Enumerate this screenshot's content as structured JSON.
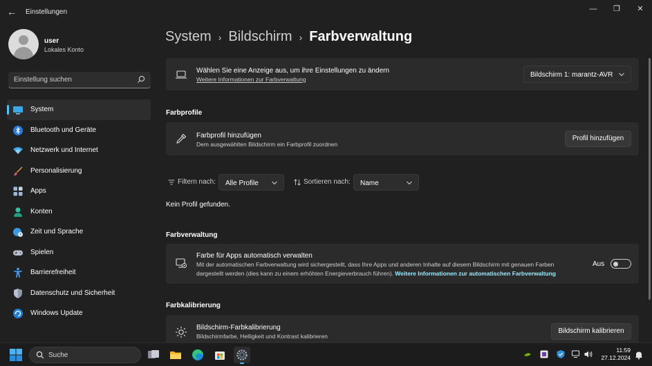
{
  "window": {
    "title": "Einstellungen",
    "back_glyph": "←",
    "minimize_glyph": "—",
    "maximize_glyph": "❐",
    "close_glyph": "✕"
  },
  "user": {
    "name": "user",
    "account": "Lokales Konto"
  },
  "search": {
    "placeholder": "Einstellung suchen"
  },
  "nav": {
    "items": [
      {
        "label": "System",
        "icon": "system-monitor-icon",
        "active": true
      },
      {
        "label": "Bluetooth und Geräte",
        "icon": "bluetooth-icon"
      },
      {
        "label": "Netzwerk und Internet",
        "icon": "wifi-icon"
      },
      {
        "label": "Personalisierung",
        "icon": "brush-icon"
      },
      {
        "label": "Apps",
        "icon": "apps-icon"
      },
      {
        "label": "Konten",
        "icon": "account-icon"
      },
      {
        "label": "Zeit und Sprache",
        "icon": "globe-clock-icon"
      },
      {
        "label": "Spielen",
        "icon": "gamepad-icon"
      },
      {
        "label": "Barrierefreiheit",
        "icon": "accessibility-icon"
      },
      {
        "label": "Datenschutz und Sicherheit",
        "icon": "shield-icon"
      },
      {
        "label": "Windows Update",
        "icon": "windows-update-icon"
      }
    ]
  },
  "breadcrumb": {
    "items": [
      "System",
      "Bildschirm",
      "Farbverwaltung"
    ],
    "separator": "›"
  },
  "display_card": {
    "title": "Wählen Sie eine Anzeige aus, um ihre Einstellungen zu ändern",
    "link": "Weitere Informationen zur Farbverwaltung",
    "dropdown_value": "Bildschirm 1: marantz-AVR"
  },
  "profiles_section": {
    "title": "Farbprofile",
    "add_card": {
      "title": "Farbprofil hinzufügen",
      "subtitle": "Dem ausgewählten Bildschirm ein Farbprofil zuordnen",
      "button": "Profil hinzufügen"
    },
    "filter_label": "Filtern nach:",
    "filter_value": "Alle Profile",
    "sort_label": "Sortieren nach:",
    "sort_value": "Name",
    "empty_text": "Kein Profil gefunden."
  },
  "color_management_section": {
    "title": "Farbverwaltung",
    "card": {
      "title": "Farbe für Apps automatisch verwalten",
      "description_line1": "Mit der automatischen Farbverwaltung wird sichergestellt, dass Ihre Apps und anderen Inhalte auf diesem Bildschirm mit genauen Farben",
      "description_line2": "dargestellt werden (dies kann zu einem erhöhten Energieverbrauch führen).",
      "link": "Weitere Informationen zur automatischen Farbverwaltung",
      "toggle_label": "Aus",
      "toggle_on": false
    }
  },
  "calibration_section": {
    "title": "Farbkalibrierung",
    "card": {
      "title": "Bildschirm-Farbkalibrierung",
      "subtitle": "Bildschirmfarbe, Helligkeit und Kontrast kalibrieren",
      "button": "Bildschirm kalibrieren"
    }
  },
  "taskbar": {
    "search_text": "Suche",
    "time": "11:59",
    "date": "27.12.2024"
  },
  "colors": {
    "accent": "#4cc2ff",
    "link": "#99ebff",
    "background": "#202020",
    "card": "#2b2b2b"
  }
}
